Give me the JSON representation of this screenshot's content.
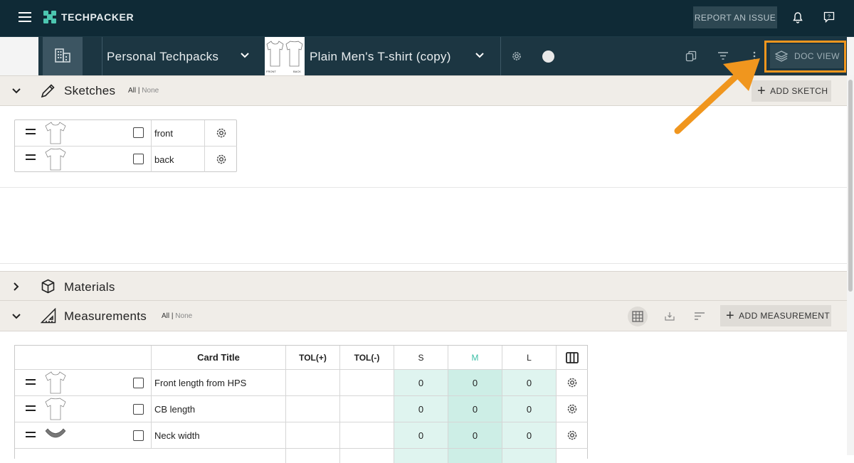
{
  "topbar": {
    "brand": "TECHPACKER",
    "report_label": "REPORT AN ISSUE",
    "icons": [
      "hamburger-icon",
      "bell-icon",
      "help-icon"
    ]
  },
  "subbar": {
    "workspace": "Personal Techpacks",
    "thumb_front": "FRONT",
    "thumb_back": "BACK",
    "product": "Plain Men's T-shirt (copy)",
    "doc_view_label": "DOC VIEW"
  },
  "sketches": {
    "title": "Sketches",
    "all": "All",
    "sep": "|",
    "none": "None",
    "add_label": "ADD SKETCH",
    "rows": [
      {
        "name": "front"
      },
      {
        "name": "back"
      }
    ]
  },
  "materials": {
    "title": "Materials"
  },
  "measurements": {
    "title": "Measurements",
    "all": "All",
    "sep": "|",
    "none": "None",
    "add_label": "ADD MEASUREMENT",
    "headers": {
      "card_title": "Card Title",
      "tol_plus": "TOL(+)",
      "tol_minus": "TOL(-)",
      "s": "S",
      "m": "M",
      "l": "L"
    },
    "rows": [
      {
        "title": "Front length from HPS",
        "s": "0",
        "m": "0",
        "l": "0"
      },
      {
        "title": "CB length",
        "s": "0",
        "m": "0",
        "l": "0"
      },
      {
        "title": "Neck width",
        "s": "0",
        "m": "0",
        "l": "0"
      }
    ]
  },
  "colors": {
    "topbar": "#0f2a36",
    "subbar": "#1c3642",
    "accent_teal": "#4cc6b0",
    "highlight_orange": "#f0961e"
  }
}
